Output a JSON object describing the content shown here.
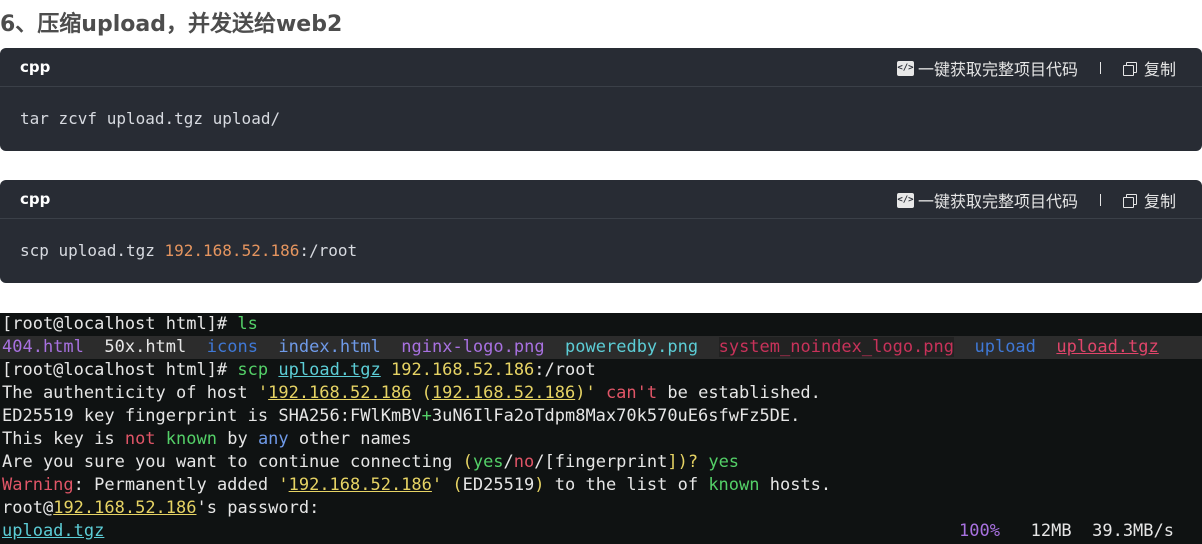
{
  "heading": "6、压缩upload，并发送给web2",
  "blocks": [
    {
      "lang": "cpp",
      "ai_label": "一键获取完整项目代码",
      "copy_label": "复制",
      "code": "tar zcvf upload.tgz upload/"
    },
    {
      "lang": "cpp",
      "ai_label": "一键获取完整项目代码",
      "copy_label": "复制",
      "code_prefix": "scp upload.tgz ",
      "code_ip": "192.168.52.186",
      "code_suffix": ":/root"
    }
  ],
  "terminal": {
    "prompt": "[root@localhost html]#",
    "cmd1": "ls",
    "files": [
      "404.html",
      "50x.html",
      "icons",
      "index.html",
      "nginx-logo.png",
      "poweredby.png",
      "system_noindex_logo.png",
      "upload",
      "upload.tgz"
    ],
    "cmd2_scp": "scp",
    "cmd2_file": "upload.tgz",
    "cmd2_ip": "192.168.52.186",
    "cmd2_suffix": ":/root",
    "l3_a": "The authenticity of host ",
    "l3_q1": "'",
    "l3_ip1": "192.168.52.186",
    "l3_paren1": " (",
    "l3_ip2": "192.168.52.186",
    "l3_paren2": ")",
    "l3_q2": "'",
    "l3_cant": " can'",
    "l3_t": "t",
    "l3_b": " be established.",
    "l4_a": "ED25519 key fingerprint is SHA256",
    "l4_colon": ":",
    "l4_fp1": "FWlKmBV",
    "l4_plus": "+",
    "l4_fp2": "3uN6IlFa2oTdpm8Max70k570uE6sfwFz5DE.",
    "l5_a": "This key is ",
    "l5_not": "not",
    "l5_known": "known",
    "l5_by": " by ",
    "l5_any": "any",
    "l5_b": " other names",
    "l6_a": "Are you sure you want to continue connecting ",
    "l6_p1": "(",
    "l6_yes": "yes",
    "l6_s1": "/",
    "l6_no": "no",
    "l6_s2": "/[",
    "l6_fp": "fingerprint",
    "l6_e": "])?",
    "l6_ans": "yes",
    "l7_warn": "Warning",
    "l7_a": ": Permanently added ",
    "l7_q1": "'",
    "l7_ip": "192.168.52.186",
    "l7_q2": "'",
    "l7_paren1": " (",
    "l7_alg": "ED25519",
    "l7_paren2": ")",
    "l7_b": " to the list of ",
    "l7_known": "known",
    "l7_c": " hosts.",
    "l8_user": "root",
    "l8_at": "@",
    "l8_ip": "192.168.52.186",
    "l8_b": "'s password:",
    "l9_file": "upload.tgz",
    "l9_pct": "100%",
    "l9_size": "12MB",
    "l9_rate": "39.3MB/s"
  }
}
